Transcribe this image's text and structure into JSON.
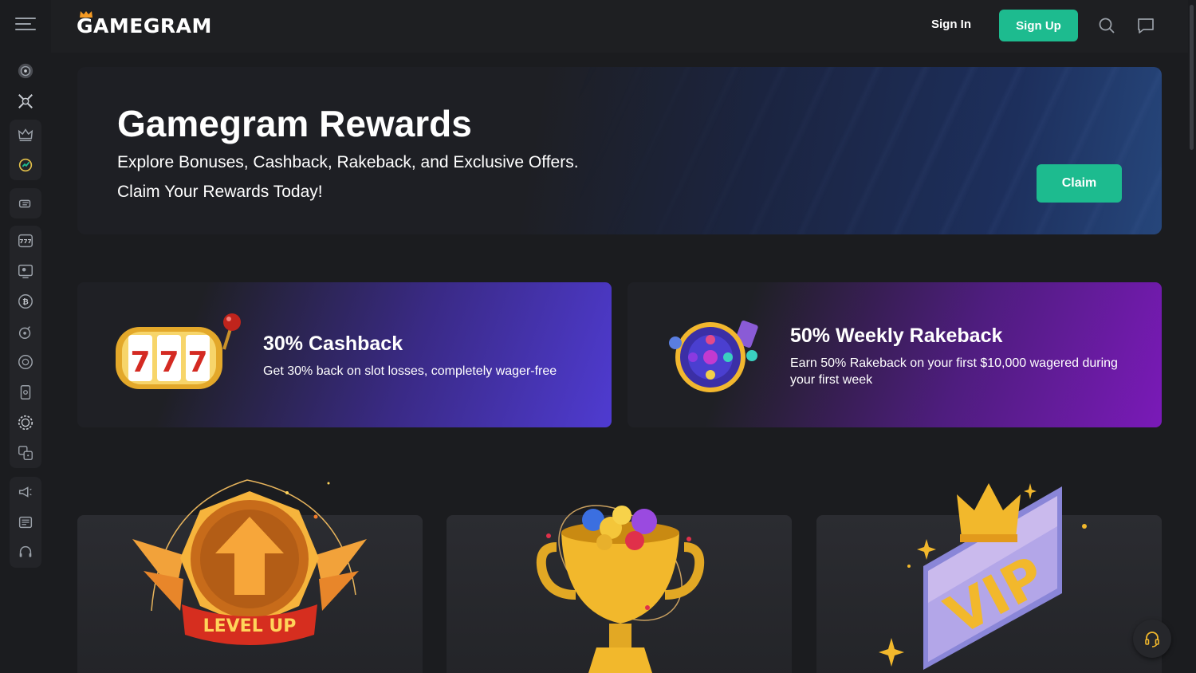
{
  "header": {
    "logo_text": "GAMEGRAM",
    "sign_in_label": "Sign In",
    "sign_up_label": "Sign Up"
  },
  "sidebar": {
    "groups": [
      [
        "casino-chip-icon",
        "crossed-swords-icon"
      ],
      [
        "crown-icon",
        "rewards-wheel-icon"
      ],
      [
        "hand-coin-icon"
      ],
      [
        "slots-777-icon",
        "live-dealer-icon",
        "bitcoin-icon",
        "bomb-icon",
        "chip-icon",
        "card-icon",
        "roulette-icon",
        "dice-icon"
      ],
      [
        "megaphone-icon",
        "news-icon",
        "headset-icon"
      ]
    ]
  },
  "hero": {
    "title": "Gamegram Rewards",
    "subtitle_line1": "Explore Bonuses, Cashback, Rakeback, and Exclusive Offers.",
    "subtitle_line2": "Claim Your Rewards Today!",
    "claim_label": "Claim"
  },
  "offers": [
    {
      "title": "30% Cashback",
      "description": "Get 30% back on slot losses, completely wager-free",
      "art": "slot-machine-777"
    },
    {
      "title": "50% Weekly Rakeback",
      "description": "Earn 50% Rakeback on your first $10,000 wagered during your first week",
      "art": "prize-wheel"
    }
  ],
  "feature_cards": [
    {
      "art": "level-up-badge",
      "badge_text": "LEVEL UP"
    },
    {
      "art": "trophy-with-coins"
    },
    {
      "art": "vip-card-with-crown",
      "badge_text": "VIP"
    }
  ],
  "colors": {
    "accent_green": "#1dbb8f",
    "background": "#1b1c1f",
    "cashback_purple": "#4f3bd1",
    "rakeback_purple": "#7a1ab8"
  }
}
